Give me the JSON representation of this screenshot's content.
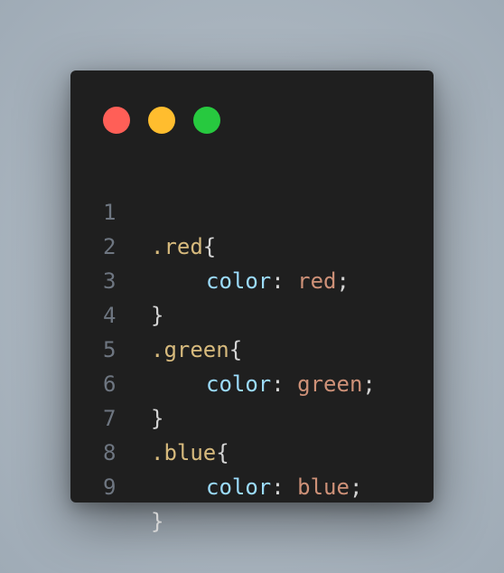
{
  "window": {
    "dots": [
      {
        "name": "close",
        "color": "#ff5f57"
      },
      {
        "name": "minimize",
        "color": "#ffbd2e"
      },
      {
        "name": "maximize",
        "color": "#27c93f"
      }
    ]
  },
  "code": {
    "lines": [
      {
        "num": "1",
        "selector": ".red",
        "open": "{"
      },
      {
        "num": "2",
        "property": "color",
        "colon": ":",
        "value": "red",
        "semi": ";"
      },
      {
        "num": "3",
        "close": "}"
      },
      {
        "num": "4",
        "selector": ".green",
        "open": "{"
      },
      {
        "num": "5",
        "property": "color",
        "colon": ":",
        "value": "green",
        "semi": ";"
      },
      {
        "num": "6",
        "close": "}"
      },
      {
        "num": "7",
        "selector": ".blue",
        "open": "{"
      },
      {
        "num": "8",
        "property": "color",
        "colon": ":",
        "value": "blue",
        "semi": ";"
      },
      {
        "num": "9",
        "close": "}"
      }
    ]
  },
  "colors": {
    "background": "#1f1f1f",
    "selector": "#d7ba7d",
    "property": "#9cdcfe",
    "value": "#ce9178",
    "punctuation": "#d4d4d4",
    "line_number": "#6e7681"
  }
}
